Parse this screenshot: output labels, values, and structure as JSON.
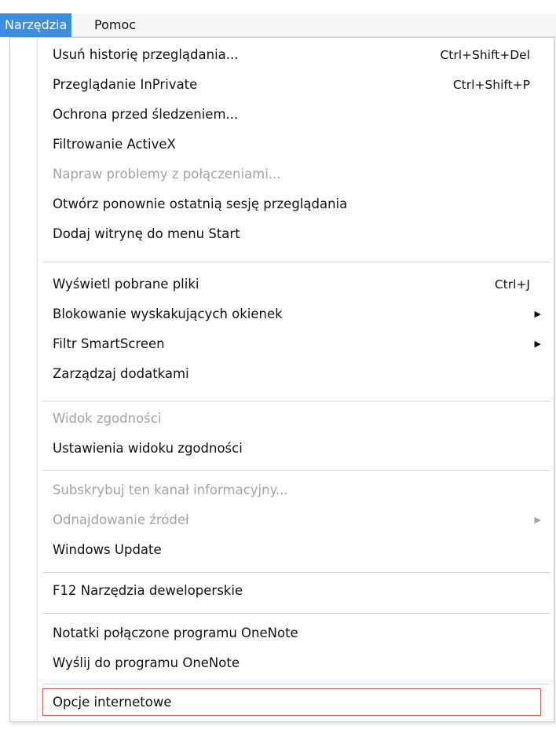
{
  "menubar": {
    "items": [
      {
        "label": "Narzędzia",
        "active": true
      },
      {
        "label": "Pomoc",
        "active": false
      }
    ]
  },
  "menu": {
    "highlight_color": "#d85a5a",
    "items": [
      {
        "label": "Usuń historię przeglądania...",
        "shortcut": "Ctrl+Shift+Del",
        "enabled": true
      },
      {
        "label": "Przeglądanie InPrivate",
        "shortcut": "Ctrl+Shift+P",
        "enabled": true
      },
      {
        "label": "Ochrona przed śledzeniem...",
        "enabled": true
      },
      {
        "label": "Filtrowanie ActiveX",
        "enabled": true
      },
      {
        "label": "Napraw problemy z połączeniami...",
        "enabled": false
      },
      {
        "label": "Otwórz ponownie ostatnią sesję przeglądania",
        "enabled": true
      },
      {
        "label": "Dodaj witrynę do menu Start",
        "enabled": true
      },
      {
        "label": "Wyświetl pobrane pliki",
        "shortcut": "Ctrl+J",
        "enabled": true
      },
      {
        "label": "Blokowanie wyskakujących okienek",
        "submenu": true,
        "enabled": true
      },
      {
        "label": "Filtr SmartScreen",
        "submenu": true,
        "enabled": true
      },
      {
        "label": "Zarządzaj dodatkami",
        "enabled": true
      },
      {
        "label": "Widok zgodności",
        "enabled": false
      },
      {
        "label": "Ustawienia widoku zgodności",
        "enabled": true
      },
      {
        "label": "Subskrybuj ten kanał informacyjny...",
        "enabled": false
      },
      {
        "label": "Odnajdowanie źródeł",
        "submenu": true,
        "enabled": false
      },
      {
        "label": "Windows Update",
        "enabled": true
      },
      {
        "label": "F12 Narzędzia deweloperskie",
        "enabled": true
      },
      {
        "label": "Notatki połączone programu OneNote",
        "enabled": true
      },
      {
        "label": "Wyślij do programu OneNote",
        "enabled": true
      },
      {
        "label": "Opcje internetowe",
        "enabled": true,
        "highlighted": true
      }
    ]
  }
}
